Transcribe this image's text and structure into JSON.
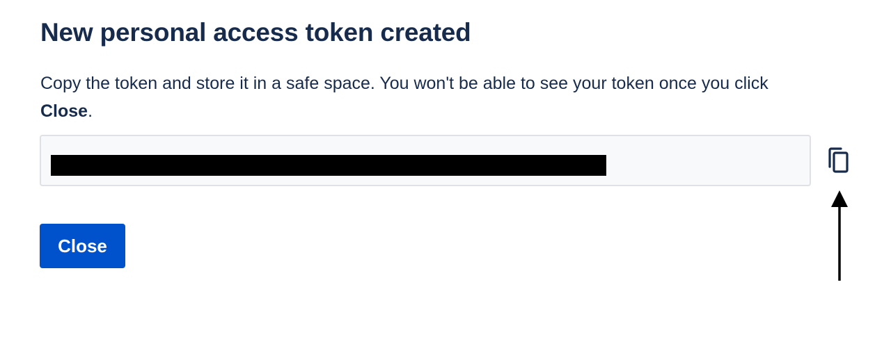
{
  "dialog": {
    "title": "New personal access token created",
    "description_before": "Copy the token and store it in a safe space. You won't be able to see your token once you click ",
    "description_emphasis": "Close",
    "description_after": ".",
    "token_value": "",
    "copy_icon": "copy-icon",
    "close_label": "Close"
  },
  "colors": {
    "primary_button": "#0052cc",
    "text": "#172b4d",
    "field_background": "#f8f9fb",
    "field_border": "#dfe1e6"
  }
}
